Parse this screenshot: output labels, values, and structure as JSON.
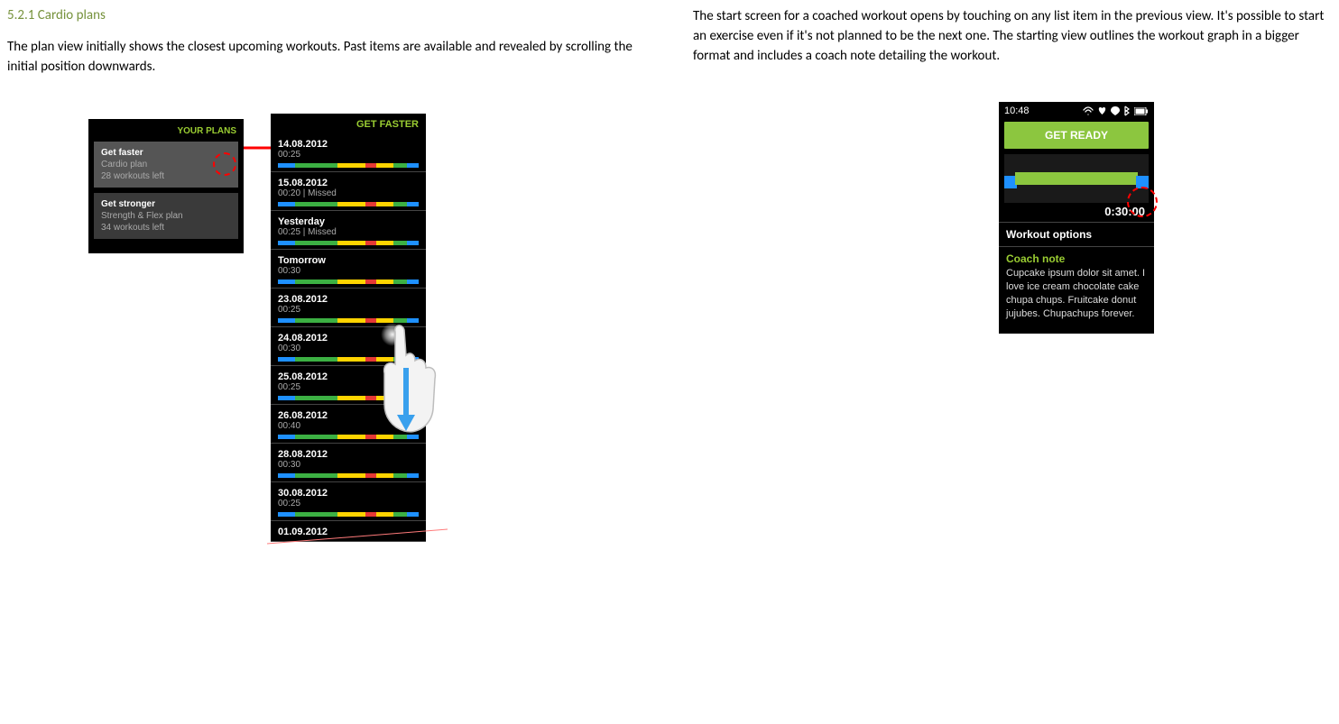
{
  "left": {
    "heading": "5.2.1 Cardio plans",
    "paragraph": "The plan view initially shows the closest upcoming workouts. Past items are available and revealed by scrolling the initial position downwards."
  },
  "right": {
    "paragraph": "The start screen for a coached workout opens by touching on any list item in the previous view. It's possible to start an exercise even if it's not planned to be the next one. The starting view outlines the workout graph in a bigger format and includes a coach note detailing the workout."
  },
  "plans_screen": {
    "header": "YOUR PLANS",
    "items": [
      {
        "title": "Get faster",
        "sub1": "Cardio plan",
        "sub2": "28 workouts left"
      },
      {
        "title": "Get stronger",
        "sub1": "Strength & Flex plan",
        "sub2": "34 workouts left"
      }
    ]
  },
  "faster_screen": {
    "header": "GET FASTER",
    "rows": [
      {
        "date": "14.08.2012",
        "dur": "00:25"
      },
      {
        "date": "15.08.2012",
        "dur": "00:20 | Missed"
      },
      {
        "date": "Yesterday",
        "dur": "00:25 | Missed"
      },
      {
        "date": "Tomorrow",
        "dur": "00:30"
      },
      {
        "date": "23.08.2012",
        "dur": "00:25"
      },
      {
        "date": "24.08.2012",
        "dur": "00:30"
      },
      {
        "date": "25.08.2012",
        "dur": "00:25"
      },
      {
        "date": "26.08.2012",
        "dur": "00:40"
      },
      {
        "date": "28.08.2012",
        "dur": "00:30"
      },
      {
        "date": "30.08.2012",
        "dur": "00:25"
      },
      {
        "date": "01.09.2012",
        "dur": ""
      }
    ]
  },
  "ready_screen": {
    "clock": "10:48",
    "button": "GET READY",
    "duration": "0:30:00",
    "options": "Workout options",
    "coach_title": "Coach note",
    "coach_text": "Cupcake ipsum dolor sit amet. I love ice cream chocolate cake chupa chups. Fruitcake donut jujubes. Chupachups forever."
  }
}
